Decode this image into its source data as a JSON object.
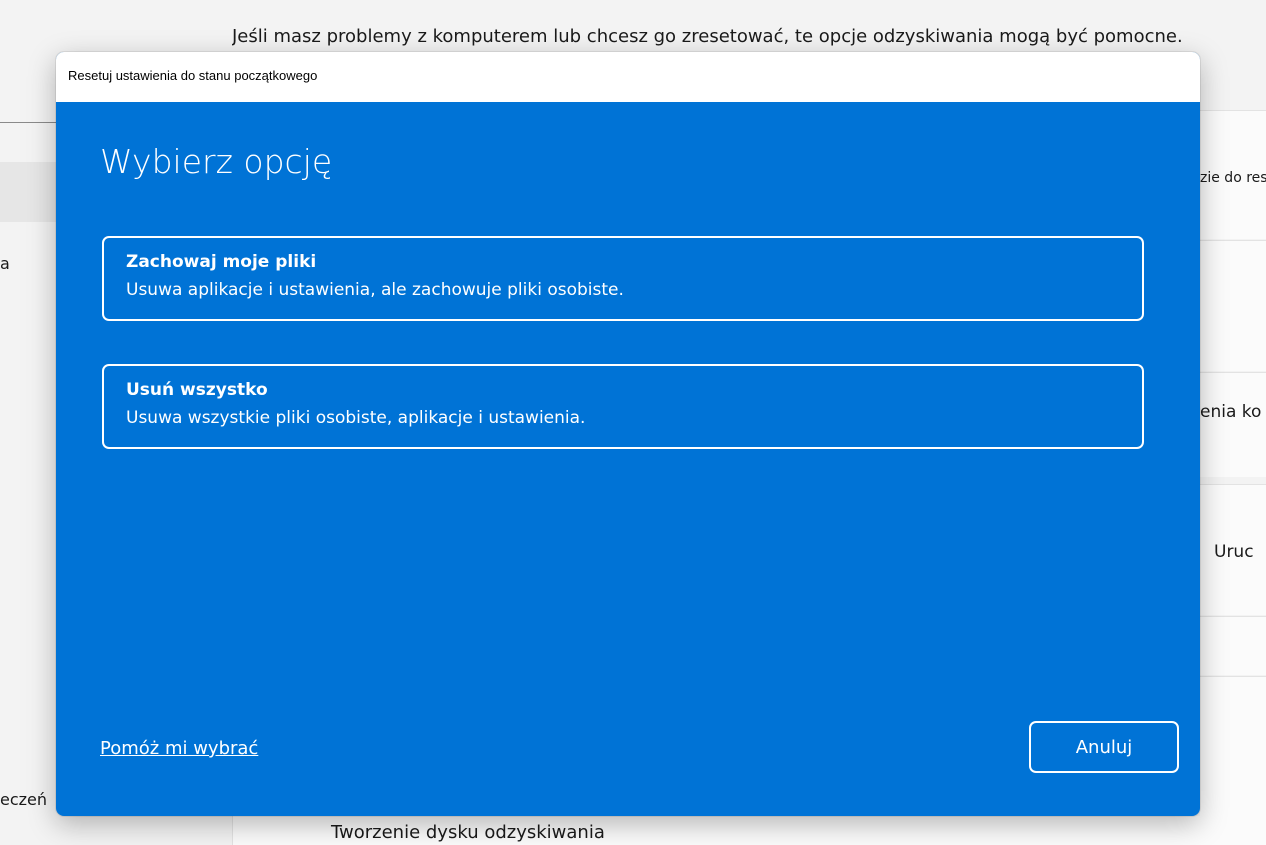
{
  "background": {
    "intro_text": "Jeśli masz problemy z komputerem lub chcesz go zresetować, te opcje odzyskiwania mogą być pomocne.",
    "sidebar_fragment_1": "a",
    "sidebar_fragment_2": "eczeń",
    "card_fragment_1": "zie do resetowania",
    "card_fragment_2": "enia ko",
    "card_button_fragment": "Uruc",
    "bottom_link": "Tworzenie dysku odzyskiwania"
  },
  "dialog": {
    "title": "Resetuj ustawienia do stanu początkowego",
    "heading": "Wybierz opcję",
    "options": [
      {
        "title": "Zachowaj moje pliki",
        "description": "Usuwa aplikacje i ustawienia, ale zachowuje pliki osobiste."
      },
      {
        "title": "Usuń wszystko",
        "description": "Usuwa wszystkie pliki osobiste, aplikacje i ustawienia."
      }
    ],
    "help_link": "Pomóż mi wybrać",
    "cancel_label": "Anuluj"
  },
  "colors": {
    "dialog_background": "#0073d6",
    "dialog_foreground": "#ffffff",
    "titlebar_background": "#ffffff"
  }
}
